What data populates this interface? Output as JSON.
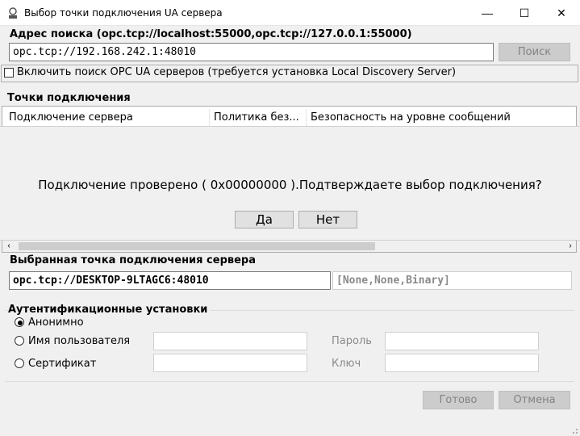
{
  "window": {
    "title": "Выбор точки подключения UA сервера",
    "minimize_glyph": "—",
    "maximize_glyph": "☐",
    "close_glyph": "✕"
  },
  "search": {
    "label": "Адрес поиска (opc.tcp://localhost:55000,opc.tcp://127.0.0.1:55000)",
    "value": "opc.tcp://192.168.242.1:48010",
    "button": "Поиск"
  },
  "discovery": {
    "checkbox_label": "Включить поиск OPC UA серверов (требуется установка Local Discovery Server)",
    "checked": false
  },
  "endpoints": {
    "label": "Точки подключения",
    "columns": [
      "Подключение сервера",
      "Политика без...",
      "Безопасность на уровне сообщений"
    ]
  },
  "confirm": {
    "message": "Подключение проверено ( 0x00000000 ).Подтверждаете выбор подключения?",
    "yes": "Да",
    "no": "Нет"
  },
  "selected": {
    "label": "Выбранная точка подключения сервера",
    "endpoint": "opc.tcp://DESKTOP-9LTAGC6:48010",
    "security": "[None,None,Binary]"
  },
  "auth": {
    "label": "Аутентификационные установки",
    "anonymous": "Анонимно",
    "username": "Имя пользователя",
    "certificate": "Сертификат",
    "password": "Пароль",
    "key": "Ключ"
  },
  "footer": {
    "ok": "Готово",
    "cancel": "Отмена"
  }
}
